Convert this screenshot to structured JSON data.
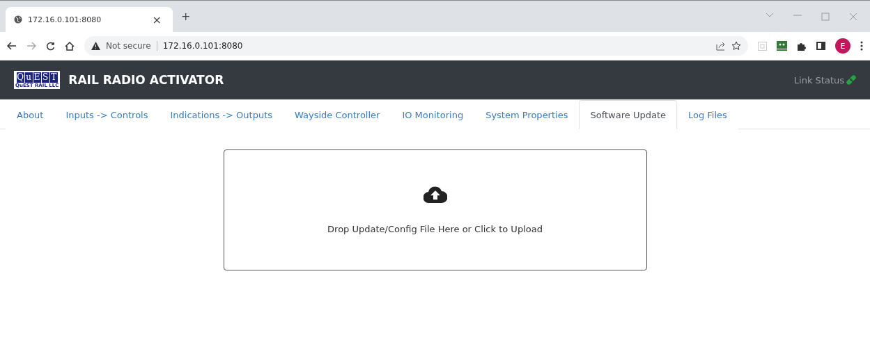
{
  "browser": {
    "tab_title": "172.16.0.101:8080",
    "close": "×",
    "new_tab": "+",
    "security": "Not secure",
    "address": "172.16.0.101:8080",
    "avatar": "E"
  },
  "app": {
    "logo_letters": [
      "Q",
      "u",
      "E",
      "S",
      "T"
    ],
    "logo_caption": "QuEST RAIL LLC",
    "title": "RAIL RADIO ACTIVATOR",
    "link_status": "Link Status",
    "linked": true
  },
  "tabs": [
    {
      "label": "About",
      "selected": false
    },
    {
      "label": "Inputs -> Controls",
      "selected": false
    },
    {
      "label": "Indications -> Outputs",
      "selected": false
    },
    {
      "label": "Wayside Controller",
      "selected": false
    },
    {
      "label": "IO Monitoring",
      "selected": false
    },
    {
      "label": "System Properties",
      "selected": false
    },
    {
      "label": "Software Update",
      "selected": true
    },
    {
      "label": "Log Files",
      "selected": false
    }
  ],
  "dropzone": {
    "text": "Drop Update/Config File Here or Click to Upload"
  }
}
